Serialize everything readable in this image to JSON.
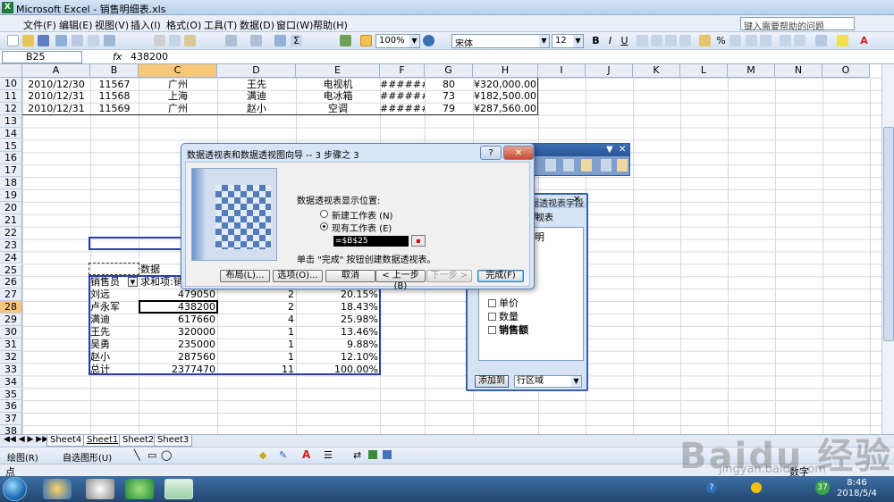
{
  "app": {
    "title": "Microsoft Excel - 销售明细表.xls"
  },
  "menu": {
    "items": [
      "文件(F)",
      "编辑(E)",
      "视图(V)",
      "插入(I)",
      "格式(O)",
      "工具(T)",
      "数据(D)",
      "窗口(W)",
      "帮助(H)"
    ],
    "help_placeholder": "键入需要帮助的问题"
  },
  "toolbar": {
    "zoom": "100%",
    "font": "宋体",
    "font_size": "12"
  },
  "formula_bar": {
    "name_box": "B25",
    "fx": "fx",
    "value": "438200"
  },
  "columns": [
    "A",
    "B",
    "C",
    "D",
    "E",
    "F",
    "G",
    "H",
    "I",
    "J",
    "K",
    "L",
    "M",
    "N",
    "O"
  ],
  "rows": [
    "10",
    "11",
    "12",
    "13",
    "14",
    "15",
    "16",
    "17",
    "18",
    "19",
    "20",
    "21",
    "22",
    "23",
    "24",
    "25",
    "26",
    "27",
    "28",
    "29",
    "30",
    "31",
    "32",
    "33",
    "34",
    "35",
    "36",
    "37",
    "38"
  ],
  "data_rows": [
    {
      "a": "2010/12/30",
      "b": "11567",
      "c": "广州",
      "d": "王先",
      "e": "电视机",
      "f": "#######",
      "g": "80",
      "h": "¥320,000.00"
    },
    {
      "a": "2010/12/31",
      "b": "11568",
      "c": "上海",
      "d": "满迪",
      "e": "电冰箱",
      "f": "#######",
      "g": "73",
      "h": "¥182,500.00"
    },
    {
      "a": "2010/12/31",
      "b": "11569",
      "c": "广州",
      "d": "赵小",
      "e": "空调",
      "f": "#######",
      "g": "79",
      "h": "¥287,560.00"
    }
  ],
  "pivot": {
    "data_header": "数据",
    "row_field": "销售员",
    "sum_label": "求和项:销",
    "rows": [
      {
        "name": "刘远",
        "sum": "479050",
        "count": "2",
        "pct": "20.15%"
      },
      {
        "name": "卢永军",
        "sum": "438200",
        "count": "2",
        "pct": "18.43%"
      },
      {
        "name": "满迪",
        "sum": "617660",
        "count": "4",
        "pct": "25.98%"
      },
      {
        "name": "王先",
        "sum": "320000",
        "count": "1",
        "pct": "13.46%"
      },
      {
        "name": "吴勇",
        "sum": "235000",
        "count": "1",
        "pct": "9.88%"
      },
      {
        "name": "赵小",
        "sum": "287560",
        "count": "1",
        "pct": "12.10%"
      },
      {
        "name": "总计",
        "sum": "2377470",
        "count": "11",
        "pct": "100.00%"
      }
    ]
  },
  "dialog": {
    "title": "数据透视表和数据透视图向导 -- 3 步骤之 3",
    "prompt": "数据透视表显示位置:",
    "opt_new": "新建工作表 (N)",
    "opt_existing": "现有工作表 (E)",
    "ref": "=$B$25",
    "hint": "单击 \"完成\" 按钮创建数据透视表。",
    "btn_layout": "布局(L)...",
    "btn_options": "选项(O)...",
    "btn_cancel": "取消",
    "btn_back": "< 上一步(B)",
    "btn_next": "下一步 >",
    "btn_finish": "完成(F)",
    "help": "?"
  },
  "field_list": {
    "header_tail": "视表",
    "partial": "明",
    "items": [
      "单价",
      "数量",
      "销售额"
    ],
    "add_button": "添加到",
    "area": "行区域"
  },
  "sheets": [
    "Sheet4",
    "Sheet1",
    "Sheet2",
    "Sheet3"
  ],
  "drawbar": {
    "draw": "绘图(R)",
    "autoshape": "自选图形(U)"
  },
  "status": {
    "left": "点",
    "right": "数字"
  },
  "taskbar": {
    "time": "8:46",
    "date": "2018/5/4",
    "badge": "37"
  },
  "watermark": {
    "brand": "Baidu 经验",
    "url": "jingyan.baidu.com"
  },
  "colors": {
    "accent": "#3462a8",
    "selected_header": "#f8c87a",
    "excel_green": "#1e7b34"
  }
}
